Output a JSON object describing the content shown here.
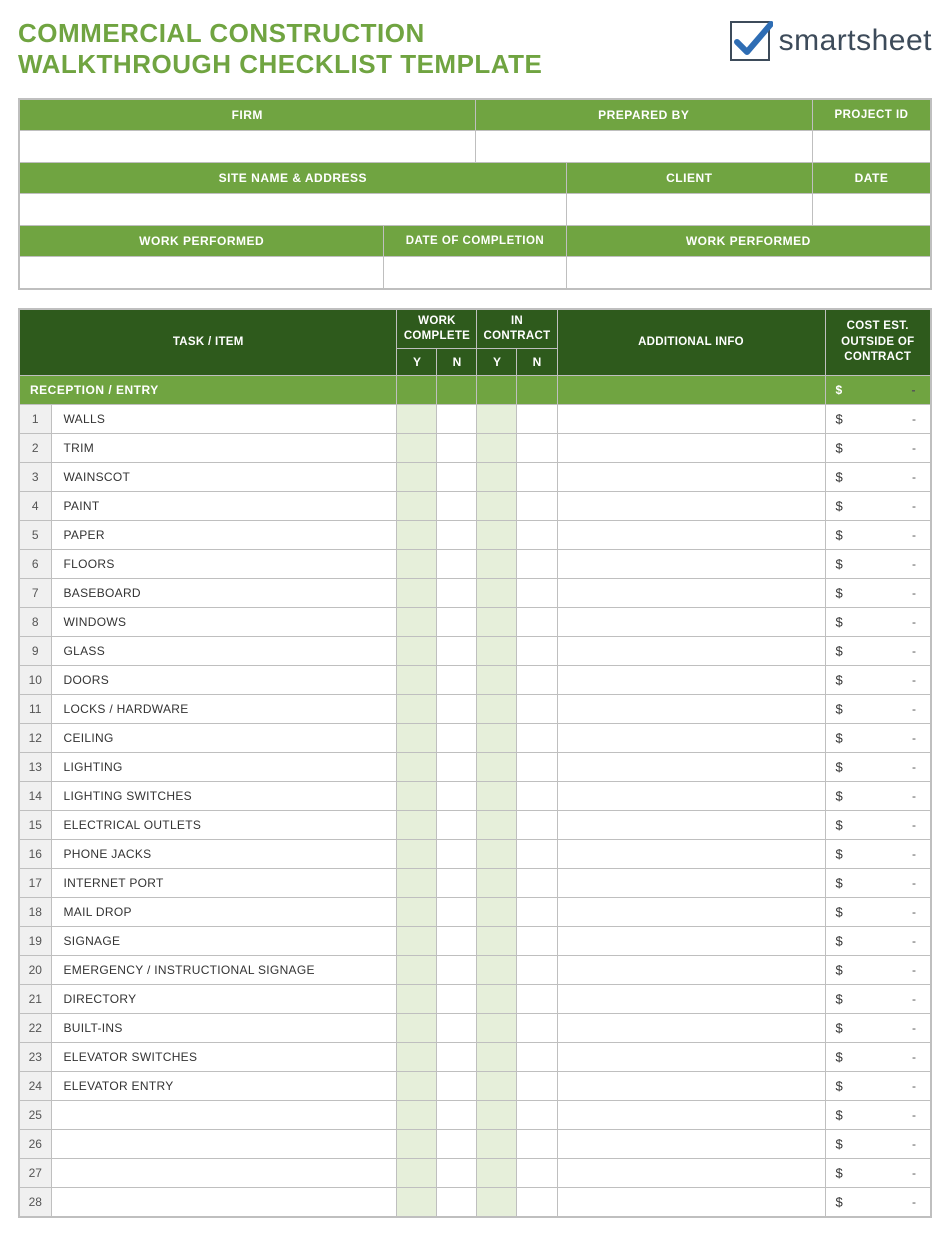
{
  "title_line1": "COMMERCIAL CONSTRUCTION",
  "title_line2": "WALKTHROUGH CHECKLIST TEMPLATE",
  "logo_text": "smartsheet",
  "info": {
    "firm": "FIRM",
    "prepared_by": "PREPARED BY",
    "project_id": "PROJECT ID",
    "site_name": "SITE NAME & ADDRESS",
    "client": "CLIENT",
    "date": "DATE",
    "work_performed_l": "WORK PERFORMED",
    "date_completion": "DATE OF COMPLETION",
    "work_performed_r": "WORK PERFORMED"
  },
  "check_headers": {
    "task": "TASK / ITEM",
    "work_complete": "WORK COMPLETE",
    "in_contract": "IN CONTRACT",
    "additional": "ADDITIONAL INFO",
    "cost_l1": "COST EST.",
    "cost_l2": "OUTSIDE OF",
    "cost_l3": "CONTRACT",
    "y": "Y",
    "n": "N"
  },
  "section": {
    "name": "RECEPTION / ENTRY",
    "cost_sym": "$",
    "cost_dash": "-"
  },
  "rows": [
    {
      "num": "1",
      "item": "WALLS"
    },
    {
      "num": "2",
      "item": "TRIM"
    },
    {
      "num": "3",
      "item": "WAINSCOT"
    },
    {
      "num": "4",
      "item": "PAINT"
    },
    {
      "num": "5",
      "item": "PAPER"
    },
    {
      "num": "6",
      "item": "FLOORS"
    },
    {
      "num": "7",
      "item": "BASEBOARD"
    },
    {
      "num": "8",
      "item": "WINDOWS"
    },
    {
      "num": "9",
      "item": "GLASS"
    },
    {
      "num": "10",
      "item": "DOORS"
    },
    {
      "num": "11",
      "item": "LOCKS / HARDWARE"
    },
    {
      "num": "12",
      "item": "CEILING"
    },
    {
      "num": "13",
      "item": "LIGHTING"
    },
    {
      "num": "14",
      "item": "LIGHTING SWITCHES"
    },
    {
      "num": "15",
      "item": "ELECTRICAL OUTLETS"
    },
    {
      "num": "16",
      "item": "PHONE JACKS"
    },
    {
      "num": "17",
      "item": "INTERNET PORT"
    },
    {
      "num": "18",
      "item": "MAIL DROP"
    },
    {
      "num": "19",
      "item": "SIGNAGE"
    },
    {
      "num": "20",
      "item": "EMERGENCY / INSTRUCTIONAL SIGNAGE"
    },
    {
      "num": "21",
      "item": "DIRECTORY"
    },
    {
      "num": "22",
      "item": "BUILT-INS"
    },
    {
      "num": "23",
      "item": "ELEVATOR SWITCHES"
    },
    {
      "num": "24",
      "item": "ELEVATOR ENTRY"
    },
    {
      "num": "25",
      "item": ""
    },
    {
      "num": "26",
      "item": ""
    },
    {
      "num": "27",
      "item": ""
    },
    {
      "num": "28",
      "item": ""
    }
  ],
  "cost_symbol": "$",
  "cost_dash": "-"
}
